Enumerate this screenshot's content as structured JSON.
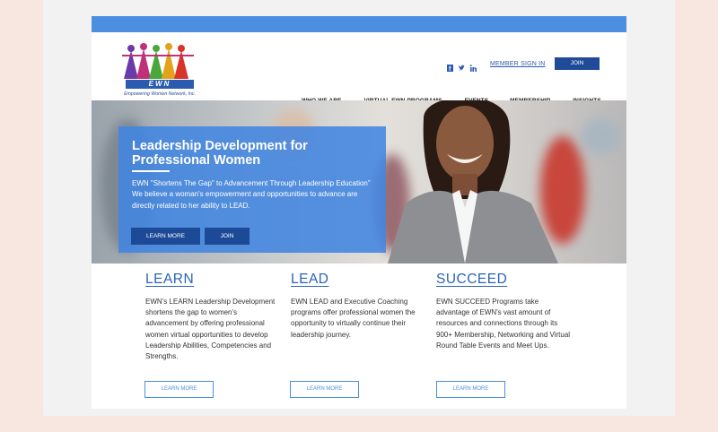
{
  "logo": {
    "brand": "EWN",
    "tagline": "Empowering Women Network, Inc."
  },
  "header": {
    "social": [
      "facebook-icon",
      "twitter-icon",
      "linkedin-icon"
    ],
    "member_link": "MEMBER SIGN IN",
    "join_label": "JOIN"
  },
  "nav": {
    "items": [
      "WHO WE ARE",
      "VIRTUAL EWN PROGRAMS",
      "EVENTS",
      "MEMBERSHIP",
      "INSIGHTS"
    ]
  },
  "hero": {
    "title": "Leadership Development for Professional Women",
    "text": "EWN \"Shortens The Gap\" to Advancement Through Leadership Education\" We believe a woman's empowerment and opportunities to advance are directly related to her ability to LEAD.",
    "learn_more": "LEARN MORE",
    "join": "JOIN"
  },
  "columns": [
    {
      "title": "LEARN",
      "text": "EWN's LEARN Leadership Development shortens the gap to women's advancement by offering professional women virtual opportunities to develop Leadership Abilities, Competencies and Strengths.",
      "button": "LEARN MORE"
    },
    {
      "title": "LEAD",
      "text": "EWN LEAD and Executive Coaching programs offer professional women the opportunity to virtually continue their leadership journey.",
      "button": "LEARN MORE"
    },
    {
      "title": "SUCCEED",
      "text": "EWN SUCCEED Programs take advantage of EWN's vast amount of resources and connections through its 900+ Membership, Networking and Virtual Round Table Events and Meet Ups.",
      "button": "LEARN MORE"
    }
  ],
  "colors": {
    "accent": "#4a8fe0",
    "dark_blue": "#1f4b98",
    "background": "#f8e6e0"
  }
}
